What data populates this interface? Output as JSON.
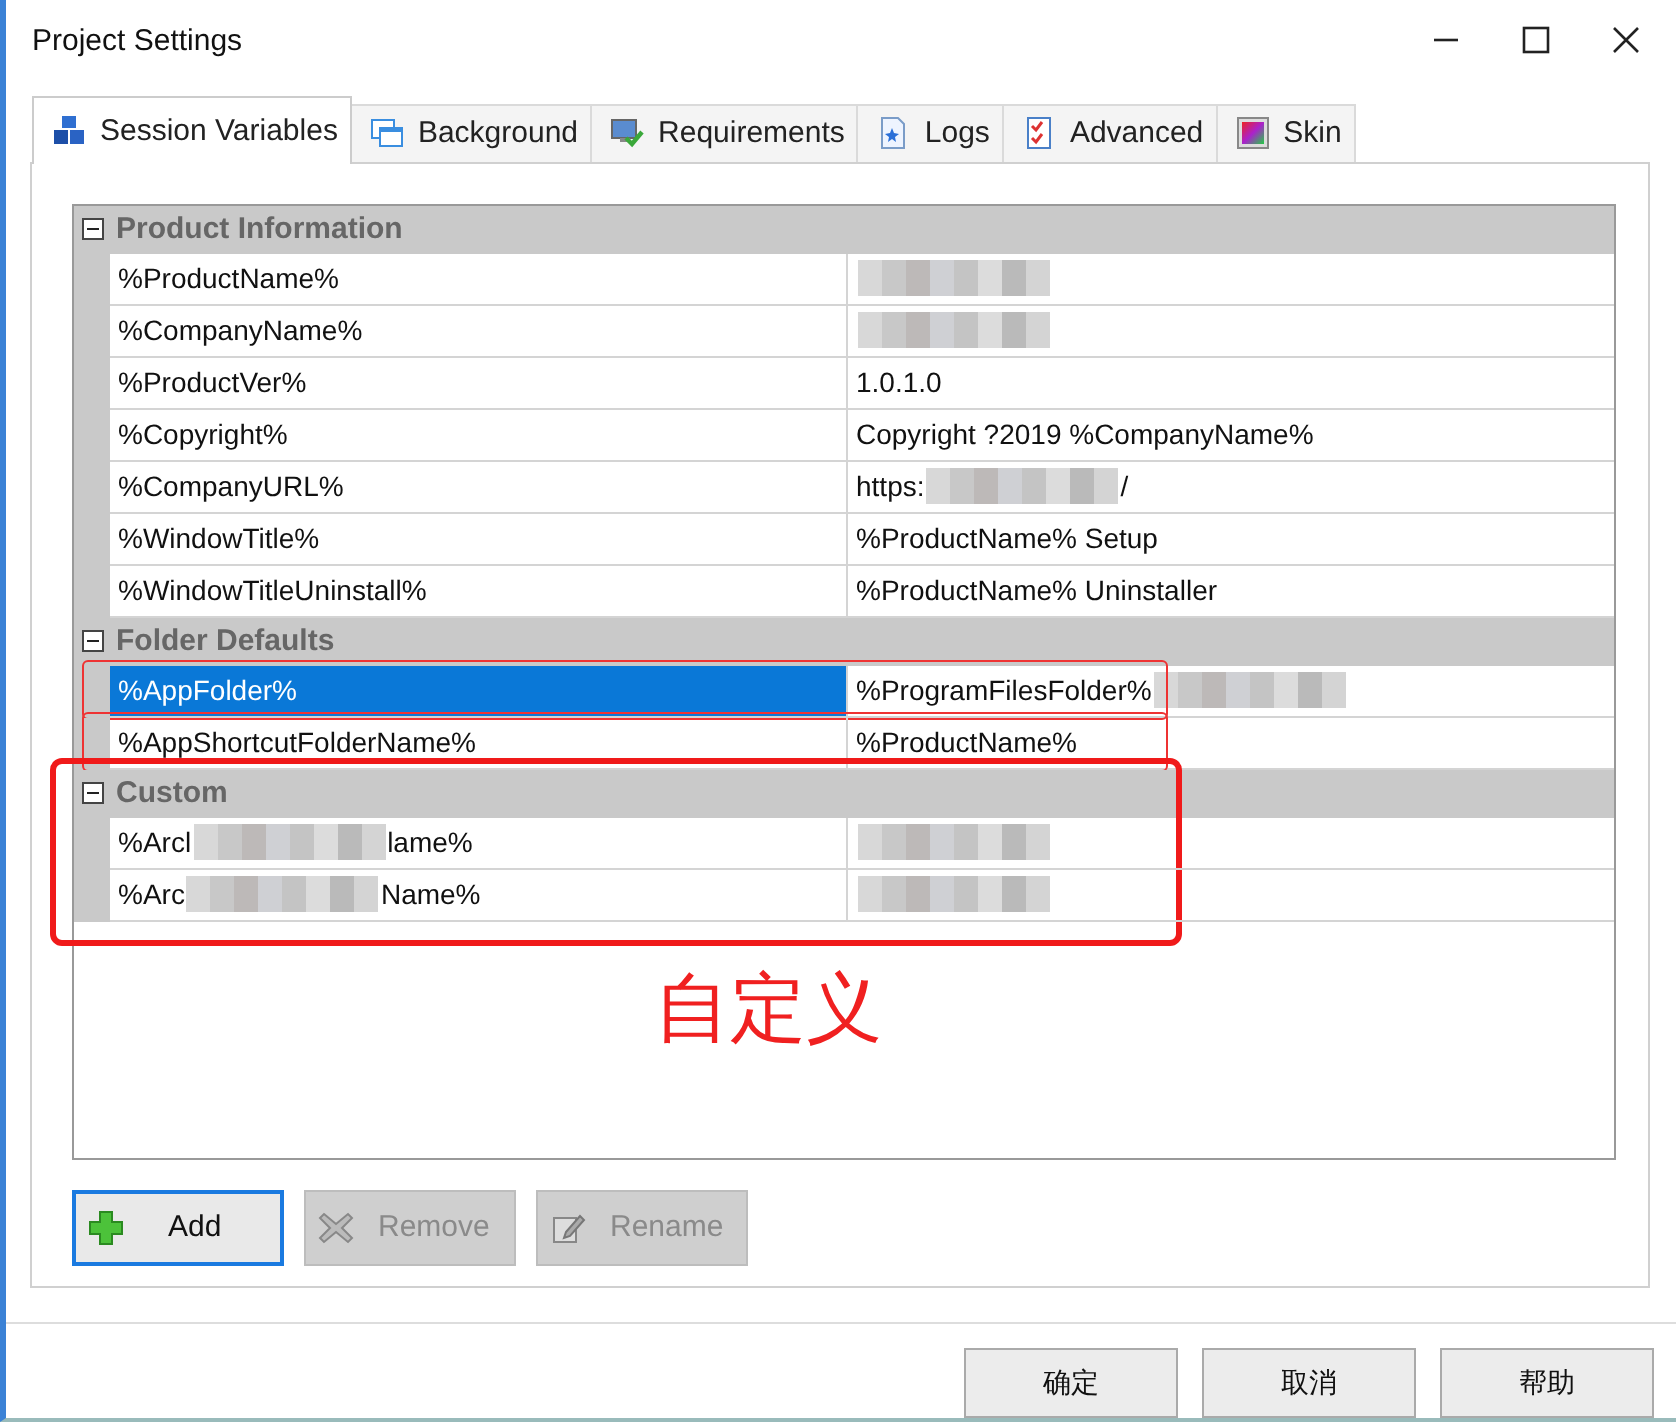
{
  "window": {
    "title": "Project Settings"
  },
  "tabs": [
    {
      "label": "Session Variables",
      "selected": true
    },
    {
      "label": "Background",
      "selected": false
    },
    {
      "label": "Requirements",
      "selected": false
    },
    {
      "label": "Logs",
      "selected": false
    },
    {
      "label": "Advanced",
      "selected": false
    },
    {
      "label": "Skin",
      "selected": false
    }
  ],
  "groups": [
    {
      "title": "Product Information",
      "expanded": true,
      "outlined": false,
      "rows": [
        {
          "name": "%ProductName%",
          "value_blurred": true,
          "selected": false,
          "outlined": false
        },
        {
          "name": "%CompanyName%",
          "value_blurred": true,
          "selected": false,
          "outlined": false
        },
        {
          "name": "%ProductVer%",
          "value": "1.0.1.0",
          "selected": false,
          "outlined": false
        },
        {
          "name": "%Copyright%",
          "value": "Copyright ?2019 %CompanyName%",
          "selected": false,
          "outlined": false
        },
        {
          "name": "%CompanyURL%",
          "value": "https:",
          "value_blurred": true,
          "value_tail": "/",
          "selected": false,
          "outlined": false
        },
        {
          "name": "%WindowTitle%",
          "value": "%ProductName% Setup",
          "selected": false,
          "outlined": false
        },
        {
          "name": "%WindowTitleUninstall%",
          "value": "%ProductName% Uninstaller",
          "selected": false,
          "outlined": false
        }
      ]
    },
    {
      "title": "Folder Defaults",
      "expanded": true,
      "outlined": false,
      "rows": [
        {
          "name": "%AppFolder%",
          "value": "%ProgramFilesFolder%",
          "value_blurred": true,
          "selected": true,
          "outlined": true
        },
        {
          "name": "%AppShortcutFolderName%",
          "value": "%ProductName%",
          "selected": false,
          "outlined": true
        }
      ]
    },
    {
      "title": "Custom",
      "expanded": true,
      "outlined": true,
      "rows": [
        {
          "name": "%Arcl",
          "name_blurred": true,
          "name_tail": "lame%",
          "value_blurred": true,
          "selected": false,
          "outlined": false
        },
        {
          "name": "%Arc",
          "name_blurred": true,
          "name_tail": "Name%",
          "value_blurred": true,
          "selected": false,
          "outlined": false
        }
      ]
    }
  ],
  "annotation": {
    "note": "自定义"
  },
  "actions": [
    {
      "label": "Add",
      "kind": "add",
      "disabled": false,
      "focused": true
    },
    {
      "label": "Remove",
      "kind": "remove",
      "disabled": true,
      "focused": false
    },
    {
      "label": "Rename",
      "kind": "rename",
      "disabled": true,
      "focused": false
    }
  ],
  "buttons": [
    {
      "label": "确定"
    },
    {
      "label": "取消"
    },
    {
      "label": "帮助"
    }
  ]
}
